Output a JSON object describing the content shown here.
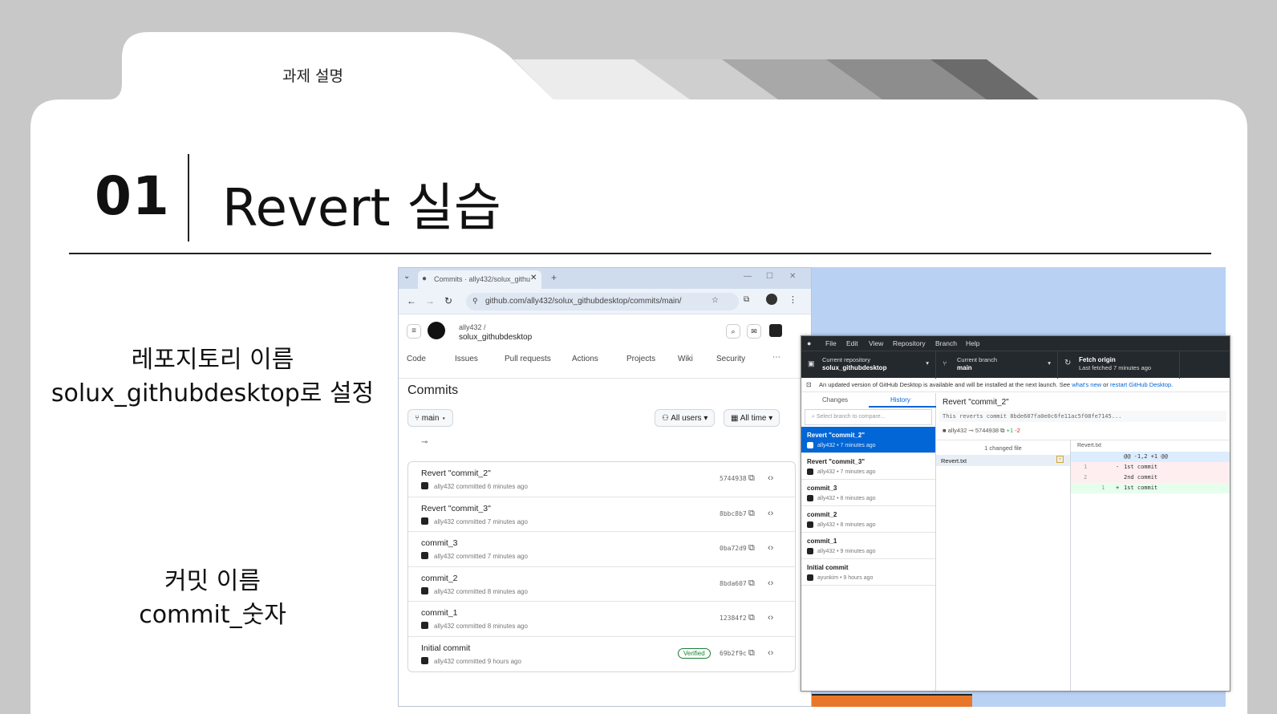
{
  "slide": {
    "tab_label": "과제 설명",
    "section_number": "01",
    "section_title": "Revert 실습",
    "desc1_line1": "레포지토리 이름",
    "desc1_line2": "solux_githubdesktop로 설정",
    "desc2_line1": "커밋 이름",
    "desc2_line2": "commit_숫자"
  },
  "browser": {
    "tab_title": "Commits · ally432/solux_githu",
    "url": "github.com/ally432/solux_githubdesktop/commits/main/",
    "owner": "ally432 /",
    "repo": "solux_githubdesktop",
    "nav": [
      "Code",
      "Issues",
      "Pull requests",
      "Actions",
      "Projects",
      "Wiki",
      "Security"
    ],
    "page_heading": "Commits",
    "branch_button": "main",
    "users_button": "All users",
    "time_button": "All time",
    "commits": [
      {
        "title": "Revert \"commit_2\"",
        "meta": "ally432 committed 6 minutes ago",
        "sha": "5744938",
        "verified": ""
      },
      {
        "title": "Revert \"commit_3\"",
        "meta": "ally432 committed 7 minutes ago",
        "sha": "8bbc8b7",
        "verified": ""
      },
      {
        "title": "commit_3",
        "meta": "ally432 committed 7 minutes ago",
        "sha": "0ba72d9",
        "verified": ""
      },
      {
        "title": "commit_2",
        "meta": "ally432 committed 8 minutes ago",
        "sha": "8bda607",
        "verified": ""
      },
      {
        "title": "commit_1",
        "meta": "ally432 committed 8 minutes ago",
        "sha": "12384f2",
        "verified": ""
      },
      {
        "title": "Initial commit",
        "meta": "ally432 committed 9 hours ago",
        "sha": "69b2f9c",
        "verified": "Verified"
      }
    ]
  },
  "desktop": {
    "menu": [
      "File",
      "Edit",
      "View",
      "Repository",
      "Branch",
      "Help"
    ],
    "repo_label": "Current repository",
    "repo_name": "solux_githubdesktop",
    "branch_label": "Current branch",
    "branch_name": "main",
    "fetch_label": "Fetch origin",
    "fetch_sub": "Last fetched 7 minutes ago",
    "notice": "An updated version of GitHub Desktop is available and will be installed at the next launch. See",
    "notice_link1": "what's new",
    "notice_mid": "or",
    "notice_link2": "restart GitHub Desktop.",
    "tab_changes": "Changes",
    "tab_history": "History",
    "compare_placeholder": "Select branch to compare...",
    "history": [
      {
        "title": "Revert \"commit_2\"",
        "meta": "ally432 • 7 minutes ago"
      },
      {
        "title": "Revert \"commit_3\"",
        "meta": "ally432 • 7 minutes ago"
      },
      {
        "title": "commit_3",
        "meta": "ally432 • 8 minutes ago"
      },
      {
        "title": "commit_2",
        "meta": "ally432 • 8 minutes ago"
      },
      {
        "title": "commit_1",
        "meta": "ally432 • 9 minutes ago"
      },
      {
        "title": "Initial commit",
        "meta": "ayunkim • 9 hours ago"
      }
    ],
    "commit_title": "Revert \"commit_2\"",
    "commit_desc": "This reverts commit 8bde607fa0e0c6fe11ac5f08fe7145...",
    "commit_author": "ally432",
    "commit_sha": "5744938",
    "additions": "+1",
    "deletions": "-2",
    "changed_files": "1 changed file",
    "file_name": "Revert.txt",
    "diff_file": "Revert.txt",
    "diff_hunk": "@@ -1,2 +1 @@",
    "diff_lines": [
      {
        "sign": "-",
        "text": "1st commit"
      },
      {
        "sign": "",
        "text": "2nd commit"
      },
      {
        "sign": "+",
        "text": "1st commit"
      }
    ]
  }
}
